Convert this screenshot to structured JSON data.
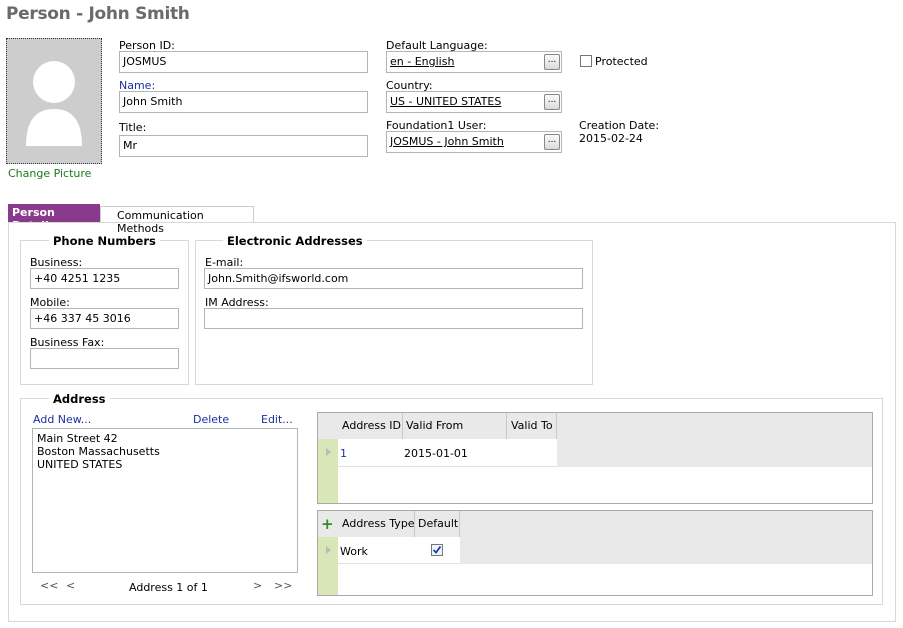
{
  "page_title": "Person - John Smith",
  "change_picture": "Change Picture",
  "fields": {
    "person_id": {
      "label": "Person ID:",
      "value": "JOSMUS"
    },
    "name": {
      "label": "Name:",
      "value": "John Smith"
    },
    "title": {
      "label": "Title:",
      "value": "Mr"
    },
    "default_language": {
      "label": "Default Language:",
      "value": "en - English"
    },
    "country": {
      "label": "Country:",
      "value": "US - UNITED STATES"
    },
    "foundation_user": {
      "label": "Foundation1 User:",
      "value": "JOSMUS - John Smith"
    },
    "protected": {
      "label": "Protected",
      "checked": false
    },
    "creation_date": {
      "label": "Creation Date:",
      "value": "2015-02-24"
    },
    "lov_button": "..."
  },
  "tabs": [
    {
      "label": "Person Details",
      "active": true
    },
    {
      "label": "Communication Methods",
      "active": false
    }
  ],
  "phone": {
    "title": "Phone Numbers",
    "business_label": "Business:",
    "business_value": "+40 4251 1235",
    "mobile_label": "Mobile:",
    "mobile_value": "+46 337 45 3016",
    "fax_label": "Business Fax:",
    "fax_value": ""
  },
  "electronic": {
    "title": "Electronic Addresses",
    "email_label": "E-mail:",
    "email_value": "John.Smith@ifsworld.com",
    "im_label": "IM Address:",
    "im_value": ""
  },
  "address": {
    "title": "Address",
    "add_new": "Add New...",
    "delete": "Delete",
    "edit": "Edit...",
    "lines": [
      "Main Street 42",
      "Boston Massachusetts",
      "UNITED STATES"
    ],
    "nav": {
      "first": "<<",
      "prev": "<",
      "counter": "Address 1 of 1",
      "next": ">",
      "last": ">>"
    },
    "grid1": {
      "columns": [
        "Address ID",
        "Valid From",
        "Valid To"
      ],
      "rows": [
        {
          "address_id": "1",
          "valid_from": "2015-01-01",
          "valid_to": ""
        }
      ]
    },
    "grid2": {
      "add_icon": "+",
      "columns": [
        "Address Type",
        "Default"
      ],
      "rows": [
        {
          "address_type": "Work",
          "default": true
        }
      ]
    }
  },
  "colors": {
    "accent_tab": "#8a3a8c",
    "link": "#1c2fa0",
    "change_picture": "#1a7a1a",
    "row_marker": "#d8e6b8"
  }
}
